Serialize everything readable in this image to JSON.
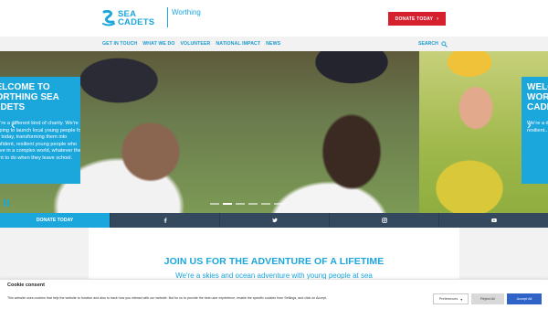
{
  "header": {
    "logo_line1": "SEA",
    "logo_line2": "CADETS",
    "unit_name": "Worthing",
    "donate_label": "DONATE TODAY",
    "donate_chevron": "›"
  },
  "nav": {
    "items": [
      {
        "label": "GET IN TOUCH"
      },
      {
        "label": "WHAT WE DO"
      },
      {
        "label": "VOLUNTEER"
      },
      {
        "label": "NATIONAL IMPACT"
      },
      {
        "label": "NEWS"
      }
    ],
    "search_label": "SEARCH"
  },
  "hero": {
    "card_title": "WELCOME TO\nWORTHING SEA\nCADETS",
    "card_body": "We're a different kind of charity. We're helping to launch local young people for the today, transforming them into confident, resilient young people who thrive in a complex world, whatever they want to do when they leave school.",
    "right_card_title": "WELC\nWORT\nCADE",
    "right_card_body": "We're a differe... young pe... Transfor... resilient... complex... do when...",
    "arrow_left": "‹",
    "arrow_right": "›",
    "slide_count": 6,
    "active_slide": 1
  },
  "social_bar": {
    "donate_label": "DONATE TODAY",
    "icons": [
      "facebook-icon",
      "twitter-icon",
      "instagram-icon",
      "youtube-icon"
    ]
  },
  "content": {
    "title": "JOIN US FOR THE ADVENTURE OF A LIFETIME",
    "subtitle": "We're a skies and ocean adventure with young people at sea"
  },
  "cookie": {
    "title": "Cookie consent",
    "text": "This website uses cookies that help the website to function and also to track how you interact with our website. But for us to provide the best user experience, enable the specific cookies from Settings, and click on Accept.",
    "preferences_label": "Preferences",
    "reject_label": "Reject All",
    "accept_label": "Accept All"
  },
  "colors": {
    "brand_blue": "#1ba6dc",
    "donate_red": "#d6202e",
    "social_bar": "#34495e",
    "accept_blue": "#2f63c8"
  }
}
